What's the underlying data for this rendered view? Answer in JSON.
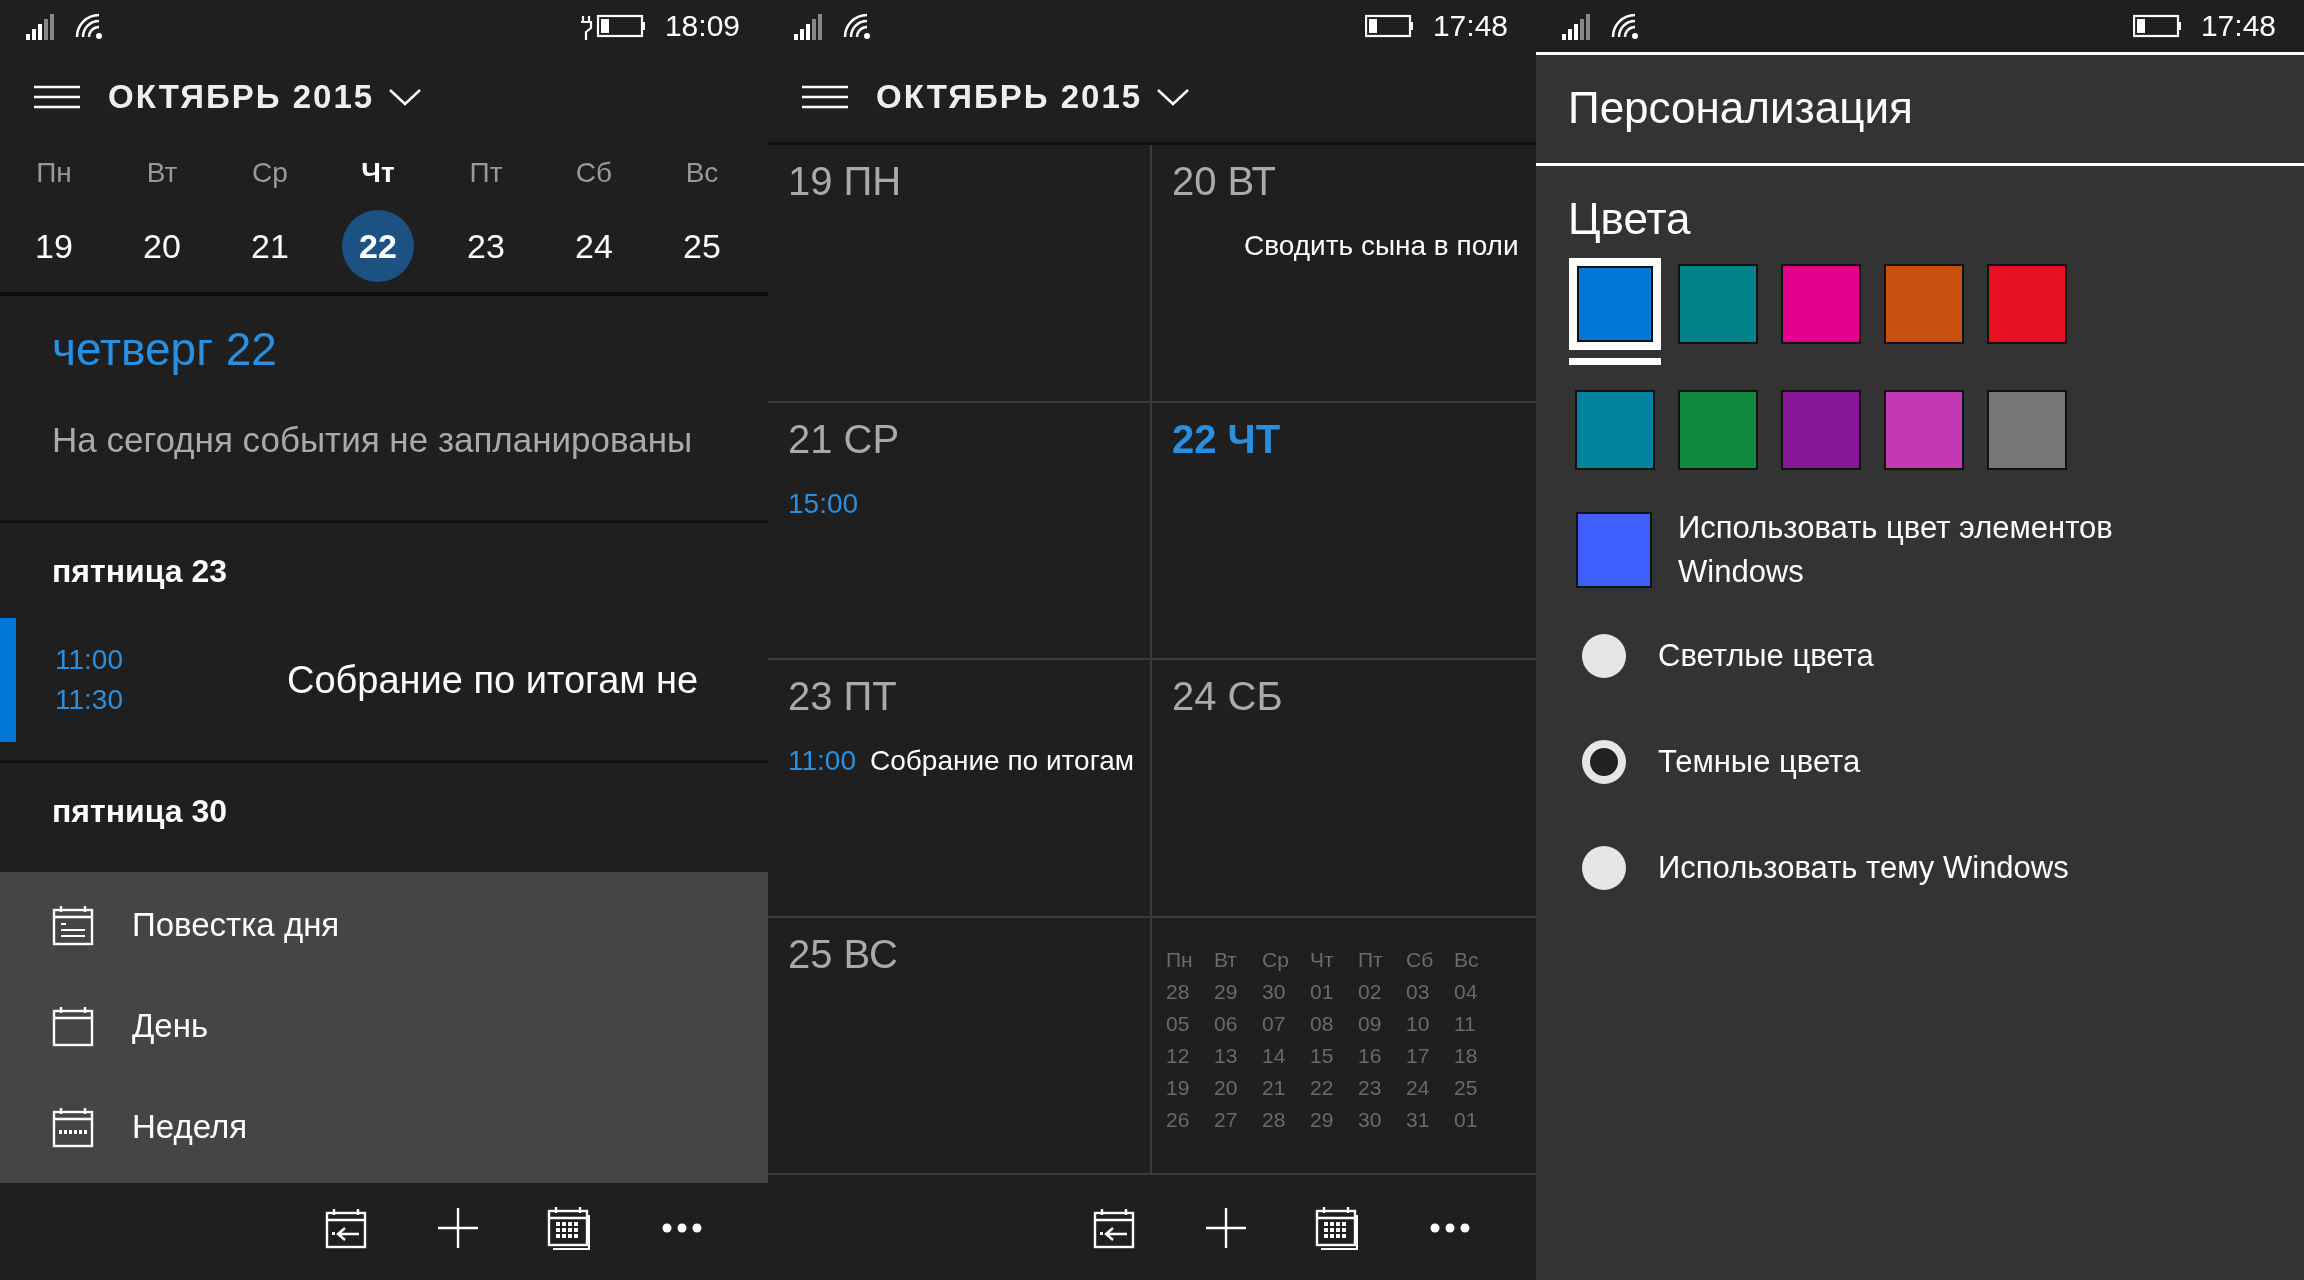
{
  "agenda_screen": {
    "status_bar": {
      "charging": true,
      "time": "18:09"
    },
    "header": {
      "title": "ОКТЯБРЬ 2015"
    },
    "week_strip": {
      "days": [
        {
          "weekday": "Пн",
          "date": "19",
          "selected": false
        },
        {
          "weekday": "Вт",
          "date": "20",
          "selected": false
        },
        {
          "weekday": "Ср",
          "date": "21",
          "selected": false
        },
        {
          "weekday": "Чт",
          "date": "22",
          "selected": true
        },
        {
          "weekday": "Пт",
          "date": "23",
          "selected": false
        },
        {
          "weekday": "Сб",
          "date": "24",
          "selected": false
        },
        {
          "weekday": "Вс",
          "date": "25",
          "selected": false
        }
      ]
    },
    "today": {
      "heading": "четверг 22",
      "empty_text": "На сегодня события не запланированы"
    },
    "days": [
      {
        "heading": "пятница 23",
        "events": [
          {
            "start": "11:00",
            "end": "11:30",
            "title": "Собрание по итогам не"
          }
        ]
      },
      {
        "heading": "пятница 30"
      }
    ],
    "view_menu": {
      "items": [
        {
          "kind": "agenda",
          "label": "Повестка дня"
        },
        {
          "kind": "day",
          "label": "День"
        },
        {
          "kind": "week",
          "label": "Неделя"
        }
      ]
    },
    "app_bar": {
      "buttons": [
        {
          "kind": "today"
        },
        {
          "kind": "add"
        },
        {
          "kind": "month"
        },
        {
          "kind": "more"
        }
      ]
    }
  },
  "week_screen": {
    "status_bar": {
      "charging": false,
      "time": "17:48"
    },
    "header": {
      "title": "ОКТЯБРЬ 2015"
    },
    "cells": [
      {
        "kind": "day",
        "label": "19 ПН",
        "today": false
      },
      {
        "kind": "day",
        "label": "20 ВТ",
        "today": false,
        "events": [
          {
            "title": "Сводить сына в поли"
          }
        ]
      },
      {
        "kind": "day",
        "label": "21 СР",
        "today": false,
        "events": [
          {
            "time": "15:00"
          }
        ]
      },
      {
        "kind": "day",
        "label": "22 ЧТ",
        "today": true
      },
      {
        "kind": "day",
        "label": "23 ПТ",
        "today": false,
        "events": [
          {
            "time": "11:00",
            "title": "Собрание по итогам"
          }
        ]
      },
      {
        "kind": "day",
        "label": "24 СБ",
        "today": false
      },
      {
        "kind": "day",
        "label": "25 ВС",
        "today": false
      },
      {
        "kind": "mini_month",
        "weekdays": [
          "Пн",
          "Вт",
          "Ср",
          "Чт",
          "Пт",
          "Сб",
          "Вс"
        ],
        "weeks": [
          [
            "28",
            "29",
            "30",
            "01",
            "02",
            "03",
            "04"
          ],
          [
            "05",
            "06",
            "07",
            "08",
            "09",
            "10",
            "11"
          ],
          [
            "12",
            "13",
            "14",
            "15",
            "16",
            "17",
            "18"
          ],
          [
            "19",
            "20",
            "21",
            "22",
            "23",
            "24",
            "25"
          ],
          [
            "26",
            "27",
            "28",
            "29",
            "30",
            "31",
            "01"
          ]
        ]
      }
    ],
    "app_bar": {
      "buttons": [
        {
          "kind": "today"
        },
        {
          "kind": "add"
        },
        {
          "kind": "month"
        },
        {
          "kind": "more"
        }
      ]
    }
  },
  "settings_screen": {
    "status_bar": {
      "charging": false,
      "time": "17:48"
    },
    "title": "Персонализация",
    "section": "Цвета",
    "swatches": [
      {
        "color": "#0078d7",
        "selected": true
      },
      {
        "color": "#00838a",
        "selected": false
      },
      {
        "color": "#e3008c",
        "selected": false
      },
      {
        "color": "#ca5010",
        "selected": false
      },
      {
        "color": "#e81123",
        "selected": false
      },
      {
        "color": "#00829e",
        "selected": false
      },
      {
        "color": "#10893e",
        "selected": false
      },
      {
        "color": "#881798",
        "selected": false
      },
      {
        "color": "#c239b3",
        "selected": false
      },
      {
        "color": "#767676",
        "selected": false
      }
    ],
    "accent_option": {
      "color": "#3f5fff",
      "label": "Использовать цвет элементов Windows"
    },
    "themes": [
      {
        "label": "Светлые цвета",
        "selected": false
      },
      {
        "label": "Темные цвета",
        "selected": true
      },
      {
        "label": "Использовать тему Windows",
        "selected": false
      }
    ]
  }
}
